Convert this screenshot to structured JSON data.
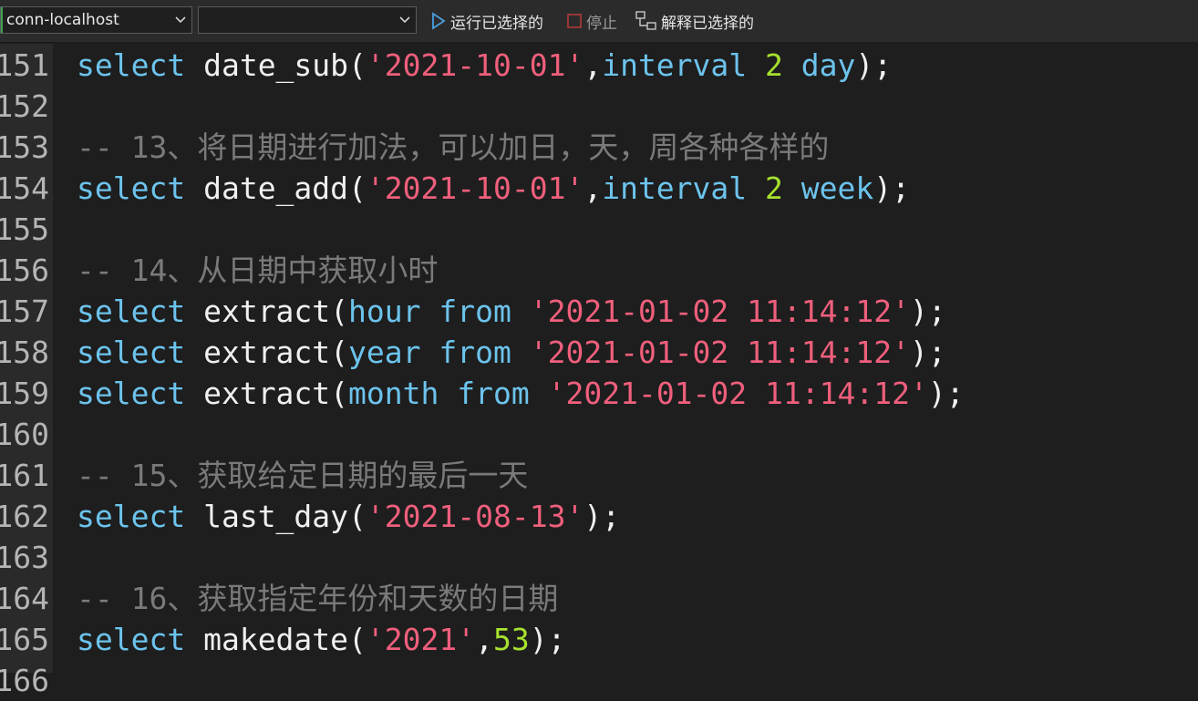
{
  "toolbar": {
    "connection": "conn-localhost",
    "database": "",
    "run_selected": "运行已选择的",
    "stop": "停止",
    "explain_selected": "解释已选择的"
  },
  "editor": {
    "lines": [
      {
        "number": "151",
        "tokens": [
          {
            "t": "kw",
            "v": "select"
          },
          {
            "t": "pl",
            "v": " date_sub("
          },
          {
            "t": "str",
            "v": "'2021-10-01'"
          },
          {
            "t": "pl",
            "v": ","
          },
          {
            "t": "kw",
            "v": "interval"
          },
          {
            "t": "pl",
            "v": " "
          },
          {
            "t": "num",
            "v": "2"
          },
          {
            "t": "pl",
            "v": " "
          },
          {
            "t": "kw",
            "v": "day"
          },
          {
            "t": "pl",
            "v": ");"
          }
        ]
      },
      {
        "number": "152",
        "tokens": []
      },
      {
        "number": "153",
        "tokens": [
          {
            "t": "cm",
            "v": "-- 13、将日期进行加法，可以加日，天，周各种各样的"
          }
        ]
      },
      {
        "number": "154",
        "tokens": [
          {
            "t": "kw",
            "v": "select"
          },
          {
            "t": "pl",
            "v": " date_add("
          },
          {
            "t": "str",
            "v": "'2021-10-01'"
          },
          {
            "t": "pl",
            "v": ","
          },
          {
            "t": "kw",
            "v": "interval"
          },
          {
            "t": "pl",
            "v": " "
          },
          {
            "t": "num",
            "v": "2"
          },
          {
            "t": "pl",
            "v": " "
          },
          {
            "t": "kw",
            "v": "week"
          },
          {
            "t": "pl",
            "v": ");"
          }
        ]
      },
      {
        "number": "155",
        "tokens": []
      },
      {
        "number": "156",
        "tokens": [
          {
            "t": "cm",
            "v": "-- 14、从日期中获取小时"
          }
        ]
      },
      {
        "number": "157",
        "tokens": [
          {
            "t": "kw",
            "v": "select"
          },
          {
            "t": "pl",
            "v": " extract("
          },
          {
            "t": "kw",
            "v": "hour"
          },
          {
            "t": "pl",
            "v": " "
          },
          {
            "t": "kw",
            "v": "from"
          },
          {
            "t": "pl",
            "v": " "
          },
          {
            "t": "str",
            "v": "'2021-01-02 11:14:12'"
          },
          {
            "t": "pl",
            "v": ");"
          }
        ]
      },
      {
        "number": "158",
        "tokens": [
          {
            "t": "kw",
            "v": "select"
          },
          {
            "t": "pl",
            "v": " extract("
          },
          {
            "t": "kw",
            "v": "year"
          },
          {
            "t": "pl",
            "v": " "
          },
          {
            "t": "kw",
            "v": "from"
          },
          {
            "t": "pl",
            "v": " "
          },
          {
            "t": "str",
            "v": "'2021-01-02 11:14:12'"
          },
          {
            "t": "pl",
            "v": ");"
          }
        ]
      },
      {
        "number": "159",
        "tokens": [
          {
            "t": "kw",
            "v": "select"
          },
          {
            "t": "pl",
            "v": " extract("
          },
          {
            "t": "kw",
            "v": "month"
          },
          {
            "t": "pl",
            "v": " "
          },
          {
            "t": "kw",
            "v": "from"
          },
          {
            "t": "pl",
            "v": " "
          },
          {
            "t": "str",
            "v": "'2021-01-02 11:14:12'"
          },
          {
            "t": "pl",
            "v": ");"
          }
        ]
      },
      {
        "number": "160",
        "tokens": []
      },
      {
        "number": "161",
        "tokens": [
          {
            "t": "cm",
            "v": "-- 15、获取给定日期的最后一天"
          }
        ]
      },
      {
        "number": "162",
        "tokens": [
          {
            "t": "kw",
            "v": "select"
          },
          {
            "t": "pl",
            "v": " last_day("
          },
          {
            "t": "str",
            "v": "'2021-08-13'"
          },
          {
            "t": "pl",
            "v": ");"
          }
        ]
      },
      {
        "number": "163",
        "tokens": []
      },
      {
        "number": "164",
        "tokens": [
          {
            "t": "cm",
            "v": "-- 16、获取指定年份和天数的日期"
          }
        ]
      },
      {
        "number": "165",
        "tokens": [
          {
            "t": "kw",
            "v": "select"
          },
          {
            "t": "pl",
            "v": " makedate("
          },
          {
            "t": "str",
            "v": "'2021'"
          },
          {
            "t": "pl",
            "v": ","
          },
          {
            "t": "num",
            "v": "53"
          },
          {
            "t": "pl",
            "v": ");"
          }
        ]
      },
      {
        "number": "166",
        "tokens": []
      }
    ]
  },
  "colors": {
    "keyword": "#6cc3ec",
    "string": "#ef5f7c",
    "number": "#a6e22e",
    "comment": "#7a7a7a",
    "background": "#1e1e1e"
  }
}
